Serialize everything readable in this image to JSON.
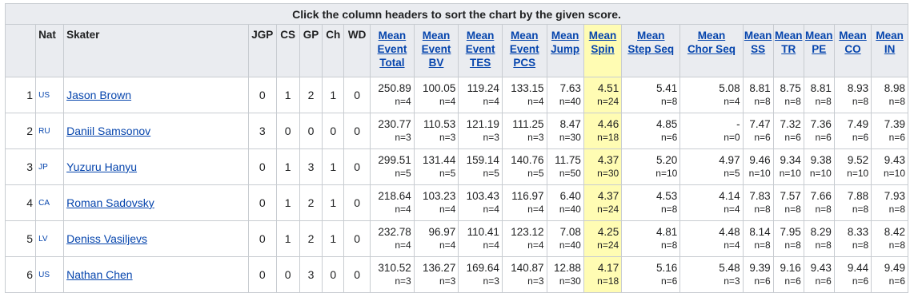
{
  "caption": "Click the column headers to sort the chart by the given score.",
  "headers": {
    "nat": "Nat",
    "skater": "Skater",
    "jgp": "JGP",
    "cs": "CS",
    "gp": "GP",
    "ch": "Ch",
    "wd": "WD",
    "metrics": [
      {
        "lines": [
          "Mean",
          "Event",
          "Total"
        ]
      },
      {
        "lines": [
          "Mean",
          "Event",
          "BV"
        ]
      },
      {
        "lines": [
          "Mean",
          "Event",
          "TES"
        ]
      },
      {
        "lines": [
          "Mean",
          "Event",
          "PCS"
        ]
      },
      {
        "lines": [
          "Mean",
          "Jump"
        ]
      },
      {
        "lines": [
          "Mean",
          "Spin"
        ]
      },
      {
        "lines": [
          "Mean",
          "Step Seq"
        ]
      },
      {
        "lines": [
          "Mean",
          "Chor Seq"
        ]
      },
      {
        "lines": [
          "Mean",
          "SS"
        ]
      },
      {
        "lines": [
          "Mean",
          "TR"
        ]
      },
      {
        "lines": [
          "Mean",
          "PE"
        ]
      },
      {
        "lines": [
          "Mean",
          "CO"
        ]
      },
      {
        "lines": [
          "Mean",
          "IN"
        ]
      }
    ]
  },
  "highlight_color": "#fffcb3",
  "rows": [
    {
      "rank": "1",
      "nat": "US",
      "skater": "Jason Brown",
      "jgp": "0",
      "cs": "1",
      "gp": "2",
      "ch": "1",
      "wd": "0",
      "metrics": [
        [
          "250.89",
          "n=4"
        ],
        [
          "100.05",
          "n=4"
        ],
        [
          "119.24",
          "n=4"
        ],
        [
          "133.15",
          "n=4"
        ],
        [
          "7.63",
          "n=40"
        ],
        [
          "4.51",
          "n=24"
        ],
        [
          "5.41",
          "n=8"
        ],
        [
          "5.08",
          "n=4"
        ],
        [
          "8.81",
          "n=8"
        ],
        [
          "8.75",
          "n=8"
        ],
        [
          "8.81",
          "n=8"
        ],
        [
          "8.93",
          "n=8"
        ],
        [
          "8.98",
          "n=8"
        ]
      ]
    },
    {
      "rank": "2",
      "nat": "RU",
      "skater": "Daniil Samsonov",
      "jgp": "3",
      "cs": "0",
      "gp": "0",
      "ch": "0",
      "wd": "0",
      "metrics": [
        [
          "230.77",
          "n=3"
        ],
        [
          "110.53",
          "n=3"
        ],
        [
          "121.19",
          "n=3"
        ],
        [
          "111.25",
          "n=3"
        ],
        [
          "8.47",
          "n=30"
        ],
        [
          "4.46",
          "n=18"
        ],
        [
          "4.85",
          "n=6"
        ],
        [
          "-",
          "n=0"
        ],
        [
          "7.47",
          "n=6"
        ],
        [
          "7.32",
          "n=6"
        ],
        [
          "7.36",
          "n=6"
        ],
        [
          "7.49",
          "n=6"
        ],
        [
          "7.39",
          "n=6"
        ]
      ]
    },
    {
      "rank": "3",
      "nat": "JP",
      "skater": "Yuzuru Hanyu",
      "jgp": "0",
      "cs": "1",
      "gp": "3",
      "ch": "1",
      "wd": "0",
      "metrics": [
        [
          "299.51",
          "n=5"
        ],
        [
          "131.44",
          "n=5"
        ],
        [
          "159.14",
          "n=5"
        ],
        [
          "140.76",
          "n=5"
        ],
        [
          "11.75",
          "n=50"
        ],
        [
          "4.37",
          "n=30"
        ],
        [
          "5.20",
          "n=10"
        ],
        [
          "4.97",
          "n=5"
        ],
        [
          "9.46",
          "n=10"
        ],
        [
          "9.34",
          "n=10"
        ],
        [
          "9.38",
          "n=10"
        ],
        [
          "9.52",
          "n=10"
        ],
        [
          "9.43",
          "n=10"
        ]
      ]
    },
    {
      "rank": "4",
      "nat": "CA",
      "skater": "Roman Sadovsky",
      "jgp": "0",
      "cs": "1",
      "gp": "2",
      "ch": "1",
      "wd": "0",
      "metrics": [
        [
          "218.64",
          "n=4"
        ],
        [
          "103.23",
          "n=4"
        ],
        [
          "103.43",
          "n=4"
        ],
        [
          "116.97",
          "n=4"
        ],
        [
          "6.40",
          "n=40"
        ],
        [
          "4.37",
          "n=24"
        ],
        [
          "4.53",
          "n=8"
        ],
        [
          "4.14",
          "n=4"
        ],
        [
          "7.83",
          "n=8"
        ],
        [
          "7.57",
          "n=8"
        ],
        [
          "7.66",
          "n=8"
        ],
        [
          "7.88",
          "n=8"
        ],
        [
          "7.93",
          "n=8"
        ]
      ]
    },
    {
      "rank": "5",
      "nat": "LV",
      "skater": "Deniss Vasiljevs",
      "jgp": "0",
      "cs": "1",
      "gp": "2",
      "ch": "1",
      "wd": "0",
      "metrics": [
        [
          "232.78",
          "n=4"
        ],
        [
          "96.97",
          "n=4"
        ],
        [
          "110.41",
          "n=4"
        ],
        [
          "123.12",
          "n=4"
        ],
        [
          "7.08",
          "n=40"
        ],
        [
          "4.25",
          "n=24"
        ],
        [
          "4.81",
          "n=8"
        ],
        [
          "4.48",
          "n=4"
        ],
        [
          "8.14",
          "n=8"
        ],
        [
          "7.95",
          "n=8"
        ],
        [
          "8.29",
          "n=8"
        ],
        [
          "8.33",
          "n=8"
        ],
        [
          "8.42",
          "n=8"
        ]
      ]
    },
    {
      "rank": "6",
      "nat": "US",
      "skater": "Nathan Chen",
      "jgp": "0",
      "cs": "0",
      "gp": "3",
      "ch": "0",
      "wd": "0",
      "metrics": [
        [
          "310.52",
          "n=3"
        ],
        [
          "136.27",
          "n=3"
        ],
        [
          "169.64",
          "n=3"
        ],
        [
          "140.87",
          "n=3"
        ],
        [
          "12.88",
          "n=30"
        ],
        [
          "4.17",
          "n=18"
        ],
        [
          "5.16",
          "n=6"
        ],
        [
          "5.48",
          "n=3"
        ],
        [
          "9.39",
          "n=6"
        ],
        [
          "9.16",
          "n=6"
        ],
        [
          "9.43",
          "n=6"
        ],
        [
          "9.44",
          "n=6"
        ],
        [
          "9.49",
          "n=6"
        ]
      ]
    }
  ]
}
